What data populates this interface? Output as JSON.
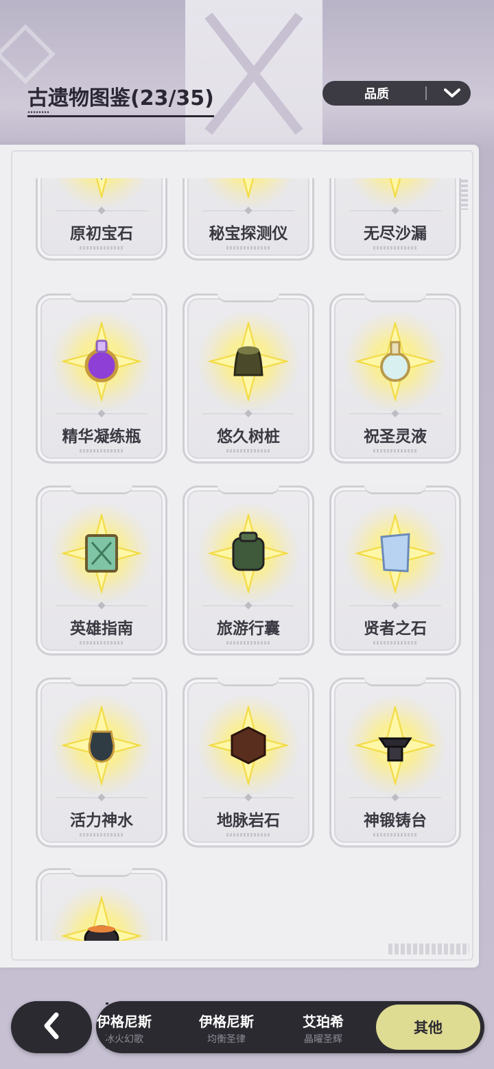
{
  "header": {
    "title": "古遗物图鉴(23/35)",
    "sort_label": "品质"
  },
  "grid": {
    "items": [
      {
        "name": "原初宝石",
        "icon": "gem-icon",
        "visible": "partial-top"
      },
      {
        "name": "秘宝探测仪",
        "icon": "compass-icon",
        "visible": "partial-top"
      },
      {
        "name": "无尽沙漏",
        "icon": "hourglass-icon",
        "visible": "partial-top"
      },
      {
        "name": "精华凝练瓶",
        "icon": "potion-bottle-icon"
      },
      {
        "name": "悠久树桩",
        "icon": "tree-stump-icon"
      },
      {
        "name": "祝圣灵液",
        "icon": "flask-icon"
      },
      {
        "name": "英雄指南",
        "icon": "book-icon"
      },
      {
        "name": "旅游行囊",
        "icon": "backpack-icon"
      },
      {
        "name": "贤者之石",
        "icon": "stone-tablet-icon"
      },
      {
        "name": "活力神水",
        "icon": "urn-icon"
      },
      {
        "name": "地脉岩石",
        "icon": "rock-cube-icon"
      },
      {
        "name": "神锻铸台",
        "icon": "anvil-icon"
      },
      {
        "name": "",
        "icon": "cauldron-icon",
        "visible": "partial-bottom"
      }
    ]
  },
  "nav": {
    "back_icon": "chevron-left-icon",
    "tabs": [
      {
        "title": "伊格尼斯",
        "subtitle": "冰火幻歌"
      },
      {
        "title": "伊格尼斯",
        "subtitle": "均衡圣律"
      },
      {
        "title": "艾珀希",
        "subtitle": "晶曜圣辉"
      }
    ],
    "active_tab": "其他"
  },
  "colors": {
    "accent_active_tab": "#dedb93",
    "nav_background": "#2c2a31",
    "glow": "#fff38a"
  }
}
